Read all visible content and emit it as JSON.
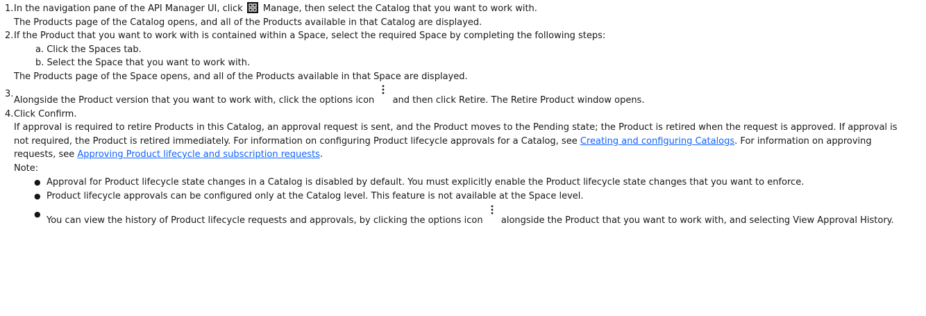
{
  "steps": [
    {
      "num": "1.",
      "text_before_icon": "In the navigation pane of the API Manager UI, click",
      "text_after_icon": "Manage, then select the Catalog that you want to work with.",
      "para2": "The Products page of the Catalog opens, and all of the Products available in that Catalog are displayed."
    },
    {
      "num": "2.",
      "text": "If the Product that you want to work with is contained within a Space, select the required Space by completing the following steps:",
      "substeps": [
        "a. Click the Spaces tab.",
        "b. Select the Space that you want to work with."
      ],
      "para2": "The Products page of the Space opens, and all of the Products available in that Space are displayed."
    },
    {
      "num": "3.",
      "text_before_icon": "Alongside the Product version that you want to work with, click the options icon",
      "text_after_icon": "and then click Retire. The Retire Product window opens."
    },
    {
      "num": "4.",
      "text": "Click Confirm.",
      "para_start": "If approval is required to retire Products in this Catalog, an approval request is sent, and the Product moves to the Pending state; the Product is retired when the request is approved. If approval is not required, the Product is retired immediately. For information on configuring Product lifecycle approvals for a Catalog, see",
      "link1": "Creating and configuring Catalogs",
      "para_mid": ". For information on approving requests, see",
      "link2": "Approving Product lifecycle and subscription requests",
      "para_end": ".",
      "note_label": "Note:",
      "notes": [
        "Approval for Product lifecycle state changes in a Catalog is disabled by default. You must explicitly enable the Product lifecycle state changes that you want to enforce.",
        "Product lifecycle approvals can be configured only at the Catalog level. This feature is not available at the Space level."
      ],
      "note3_before_icon": "You can view the history of Product lifecycle requests and approvals, by clicking the options icon",
      "note3_after_icon": "alongside the Product that you want to work with, and selecting View Approval History."
    }
  ],
  "icons": {
    "manage": "grid-icon",
    "options": "overflow-menu-vertical-icon"
  },
  "colors": {
    "text": "#161616",
    "link": "#0f62fe"
  }
}
